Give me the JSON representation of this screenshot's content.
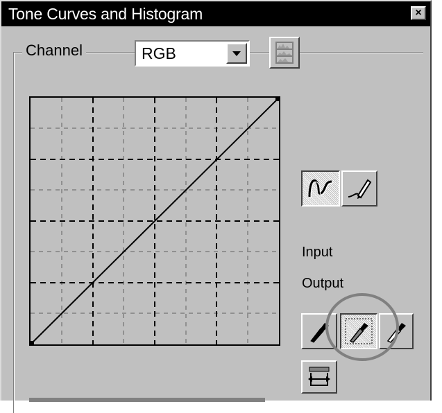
{
  "window": {
    "title": "Tone Curves and Histogram",
    "close_symbol": "×"
  },
  "channel": {
    "label": "Channel",
    "selected": "RGB"
  },
  "labels": {
    "input": "Input",
    "output": "Output"
  },
  "icons": {
    "histogram": "histogram-icon",
    "curve_tool": "curve-icon",
    "pencil_tool": "pencil-freehand-icon",
    "black_point": "black-eyedropper-icon",
    "gray_point": "gray-eyedropper-icon",
    "white_point": "white-eyedropper-icon",
    "auto": "auto-adjust-icon"
  },
  "colors": {
    "face": "#c0c0c0",
    "title_bg": "#000000",
    "highlight_circle": "#808080"
  }
}
